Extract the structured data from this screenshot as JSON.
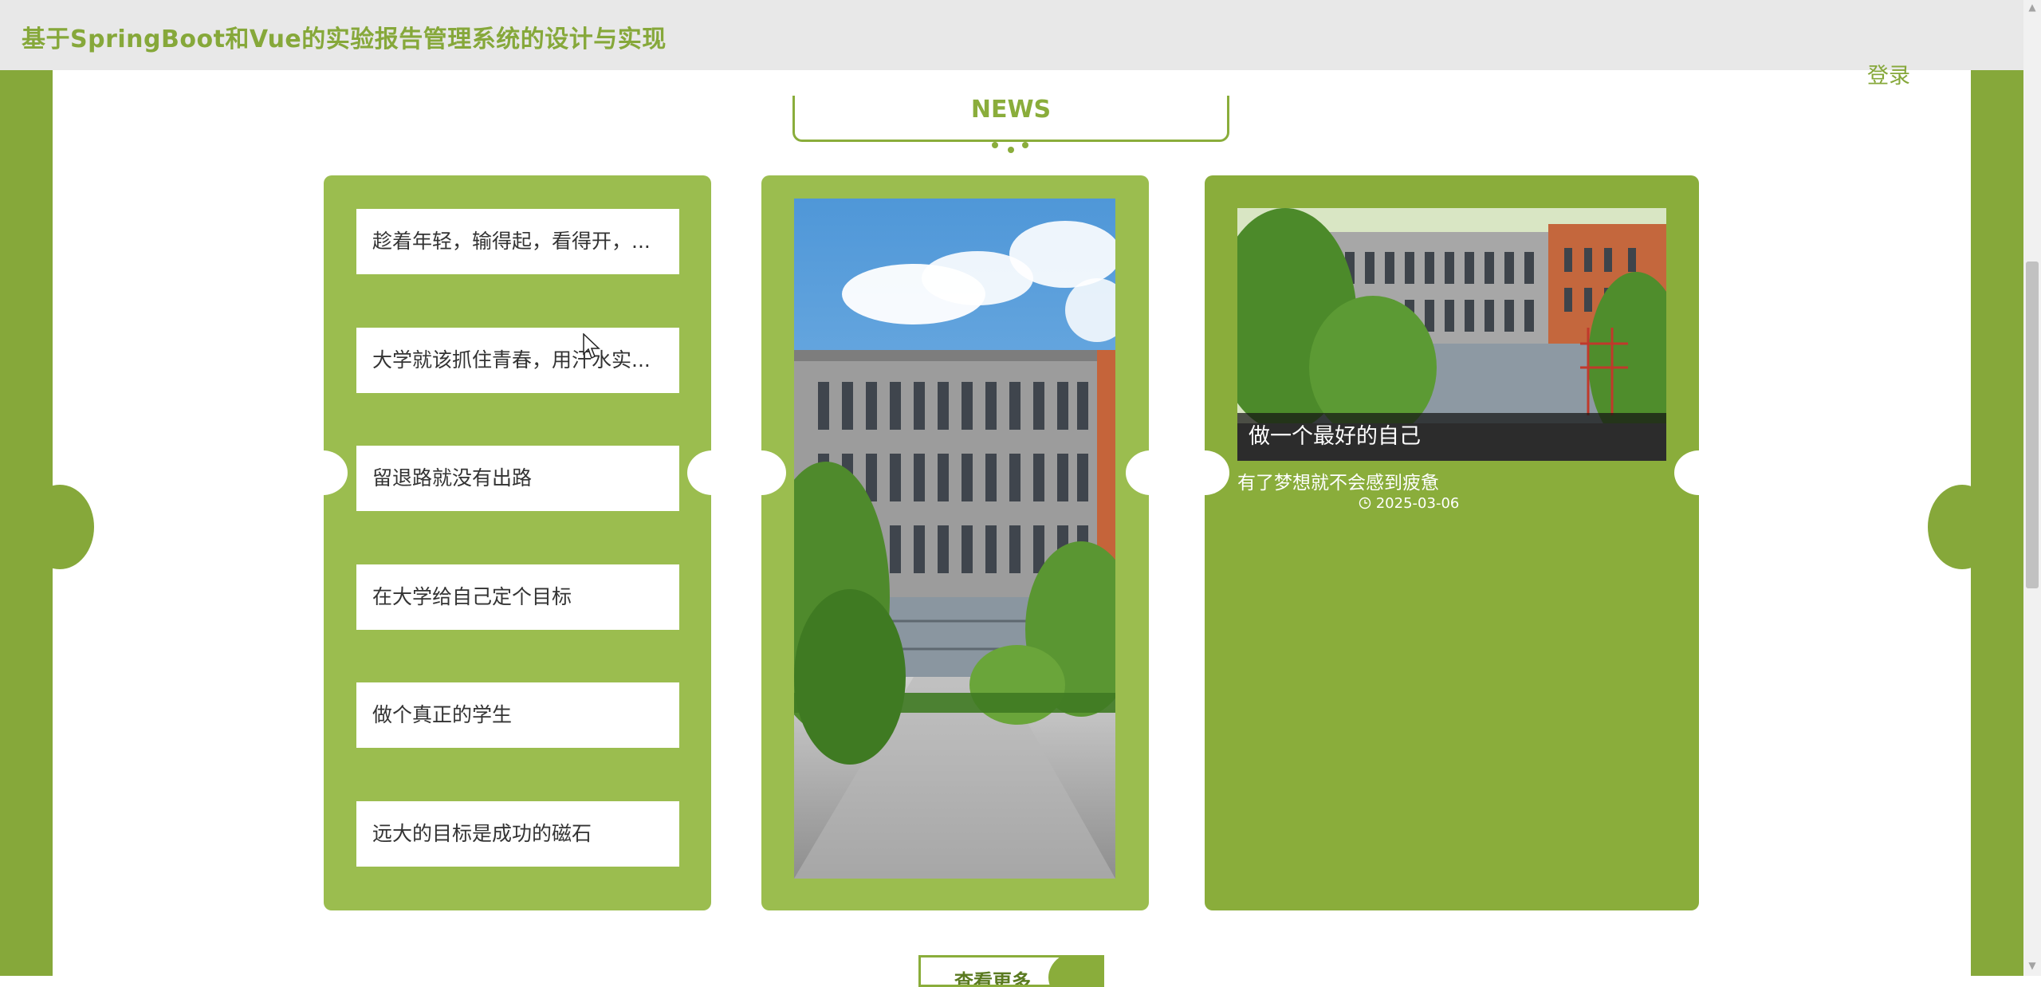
{
  "header": {
    "site_title": "基于SpringBoot和Vue的实验报告管理系统的设计与实现",
    "login_label": "登录"
  },
  "news": {
    "section_title": "NEWS",
    "list": [
      "趁着年轻，输得起，看得开，...",
      "大学就该抓住青春，用汗水实...",
      "留退路就没有出路",
      "在大学给自己定个目标",
      "做个真正的学生",
      "远大的目标是成功的磁石"
    ],
    "featured": {
      "title": "做一个最好的自己",
      "description": "有了梦想就不会感到疲惫",
      "date": "2025-03-06"
    },
    "more_label": "查看更多"
  },
  "colors": {
    "accent": "#86a83a",
    "panel_light": "#9bbd4f",
    "panel_dark": "#8aad3b"
  }
}
